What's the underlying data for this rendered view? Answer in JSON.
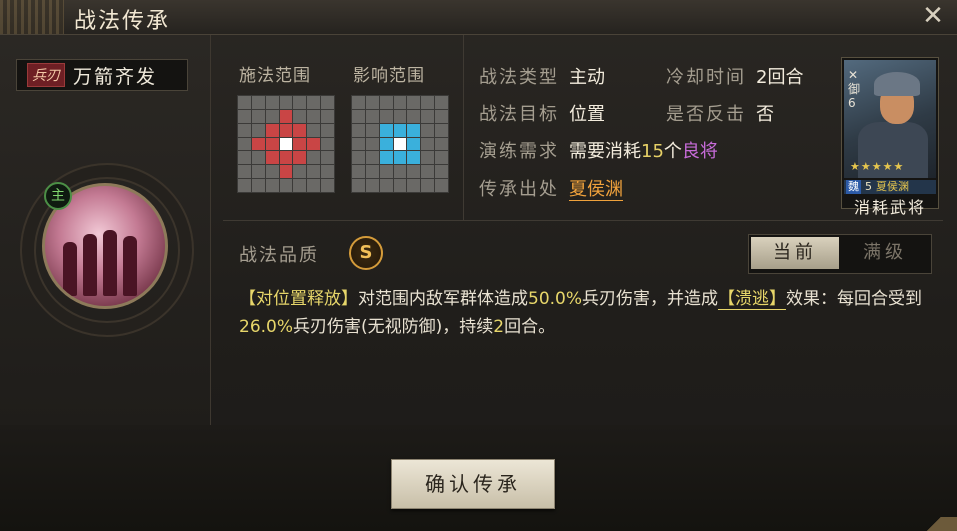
{
  "window": {
    "title": "战法传承"
  },
  "skill": {
    "type_badge": "兵刃",
    "name": "万箭齐发",
    "main_badge": "主"
  },
  "ranges": {
    "cast_label": "施法范围",
    "effect_label": "影响范围"
  },
  "info": {
    "type_label": "战法类型",
    "type_value": "主动",
    "cooldown_label": "冷却时间",
    "cooldown_value": "2回合",
    "target_label": "战法目标",
    "target_value": "位置",
    "counter_label": "是否反击",
    "counter_value": "否",
    "require_label": "演练需求",
    "require_prefix": "需要消耗",
    "require_count": "15",
    "require_unit": "个",
    "require_quality": "良将",
    "source_label": "传承出处",
    "source_value": "夏侯渊"
  },
  "card": {
    "class": "御",
    "class_level": "6",
    "stars": "★★★★★",
    "faction": "魏",
    "level": "5",
    "name": "夏侯渊",
    "caption": "消耗武将"
  },
  "quality": {
    "label": "战法品质",
    "grade": "S"
  },
  "toggle": {
    "current": "当前",
    "max": "满级"
  },
  "description": {
    "tag": "【对位置释放】",
    "part1": "对范围内敌军群体造成",
    "damage": "50.0%",
    "part2": "兵刃伤害，并造成",
    "status": "【溃逃】",
    "part3": "效果：每回合受到",
    "dot": "26.0%",
    "part4": "兵刃伤害(无视防御)，持续",
    "turns": "2",
    "part5": "回合。"
  },
  "confirm": {
    "label": "确认传承"
  },
  "colors": {
    "red_cell": "#c94545",
    "blue_cell": "#3ab0dc",
    "accent_gold": "#e7d66a",
    "purple": "#c66bd8",
    "orange": "#f0a23c"
  }
}
